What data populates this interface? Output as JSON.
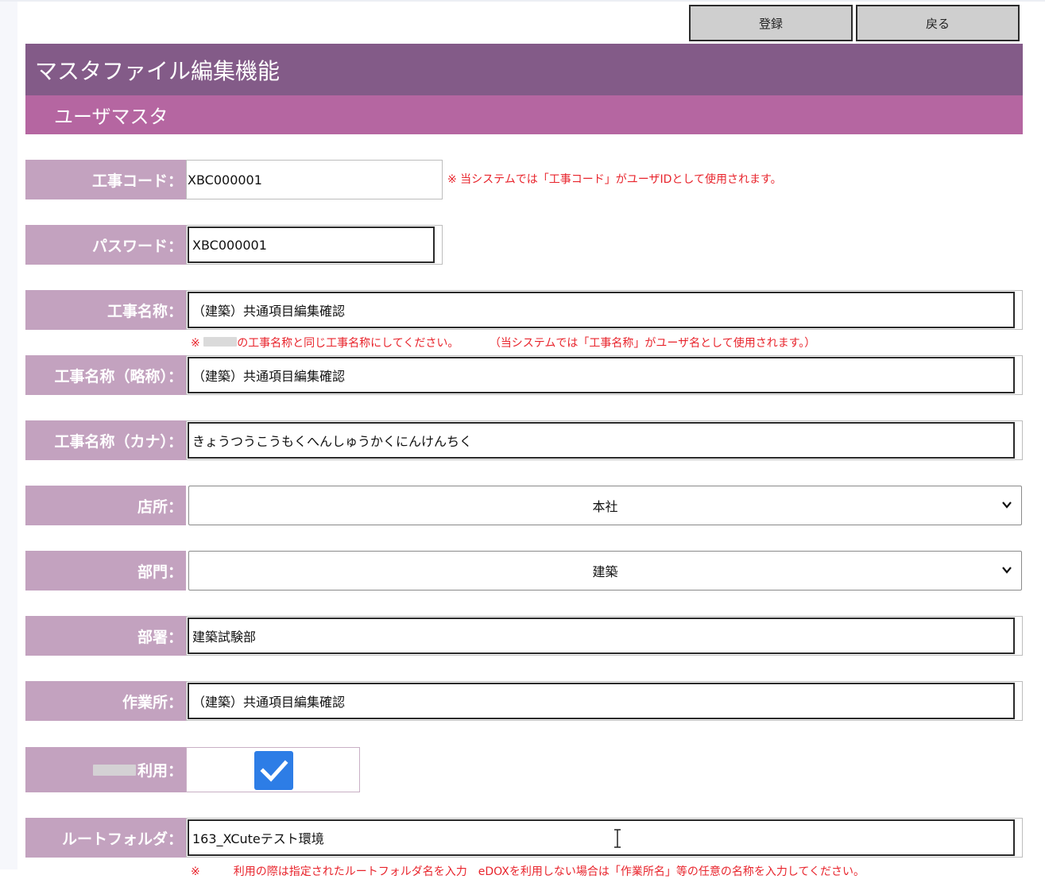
{
  "toolbar": {
    "register_label": "登録",
    "back_label": "戻る"
  },
  "header": {
    "title": "マスタファイル編集機能",
    "subtitle": "ユーザマスタ"
  },
  "form": {
    "construction_code": {
      "label": "工事コード：",
      "value": "XBC000001",
      "note": "※ 当システムでは「工事コード」がユーザIDとして使用されます。"
    },
    "password": {
      "label": "パスワード：",
      "value": "XBC000001"
    },
    "construction_name": {
      "label": "工事名称：",
      "value": "（建築）共通項目編集確認",
      "note_prefix": "※",
      "note_main": "の工事名称と同じ工事名称にしてください。",
      "note_extra": "（当システムでは「工事名称」がユーザ名として使用されます。）"
    },
    "construction_name_short": {
      "label": "工事名称（略称）：",
      "value": "（建築）共通項目編集確認"
    },
    "construction_name_kana": {
      "label": "工事名称（カナ）：",
      "value": "きょうつうこうもくへんしゅうかくにんけんちく"
    },
    "branch": {
      "label": "店所：",
      "selected": "本社"
    },
    "division": {
      "label": "部門：",
      "selected": "建築"
    },
    "department": {
      "label": "部署：",
      "value": "建築試験部"
    },
    "work_site": {
      "label": "作業所：",
      "value": "（建築）共通項目編集確認"
    },
    "usage": {
      "label_suffix": "利用：",
      "checked": true
    },
    "root_folder": {
      "label": "ルートフォルダ：",
      "value": "163_XCuteテスト環境",
      "note": "※　　　利用の際は指定されたルートフォルダ名を入力　eDOXを利用しない場合は「作業所名」等の任意の名称を入力してください。"
    }
  }
}
